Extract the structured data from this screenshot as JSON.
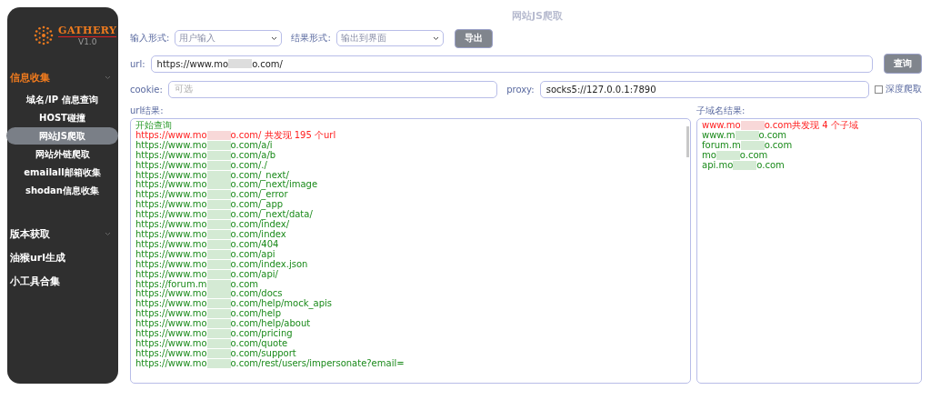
{
  "sidebar": {
    "logo": {
      "name": "GATHERY",
      "version": "V1.0"
    },
    "groups": [
      {
        "label": "信息收集",
        "expandable": true,
        "selected": true,
        "children": [
          {
            "label": "域名/IP 信息查询",
            "selected": false
          },
          {
            "label": "HOST碰撞",
            "selected": false
          },
          {
            "label": "网站JS爬取",
            "selected": true
          },
          {
            "label": "网站外链爬取",
            "selected": false
          },
          {
            "label": "emailall邮箱收集",
            "selected": false
          },
          {
            "label": "shodan信息收集",
            "selected": false
          }
        ]
      },
      {
        "label": "版本获取",
        "expandable": true,
        "selected": false
      },
      {
        "label": "油猴url生成",
        "expandable": false,
        "selected": false
      },
      {
        "label": "小工具合集",
        "expandable": false,
        "selected": false
      }
    ]
  },
  "page_title": "网站JS爬取",
  "options": {
    "input_label": "输入形式:",
    "input_value": "用户输入",
    "result_label": "结果形式:",
    "result_value": "输出到界面",
    "export_button": "导出"
  },
  "url": {
    "label": "url:",
    "prefix": "https://www.mo",
    "suffix": "o.com/",
    "button": "查询"
  },
  "cookie": {
    "label": "cookie:",
    "placeholder": "可选"
  },
  "proxy": {
    "label": "proxy:",
    "value": "socks5://127.0.0.1:7890"
  },
  "deep_crawl": {
    "label": "深度爬取",
    "checked": false
  },
  "url_results": {
    "label": "url结果:",
    "lines": [
      {
        "kind": "info",
        "text": "开始查询"
      },
      {
        "kind": "summary",
        "prefix": "https://www.mo",
        "suffix": "o.com/ 共发现 195 个url"
      },
      {
        "kind": "found",
        "prefix": "https://www.mo",
        "suffix": "o.com/a/i"
      },
      {
        "kind": "found",
        "prefix": "https://www.mo",
        "suffix": "o.com/a/b"
      },
      {
        "kind": "found",
        "prefix": "https://www.mo",
        "suffix": "o.com/./"
      },
      {
        "kind": "found",
        "prefix": "https://www.mo",
        "suffix": "o.com/_next/"
      },
      {
        "kind": "found",
        "prefix": "https://www.mo",
        "suffix": "o.com/_next/image"
      },
      {
        "kind": "found",
        "prefix": "https://www.mo",
        "suffix": "o.com/_error"
      },
      {
        "kind": "found",
        "prefix": "https://www.mo",
        "suffix": "o.com/_app"
      },
      {
        "kind": "found",
        "prefix": "https://www.mo",
        "suffix": "o.com/_next/data/"
      },
      {
        "kind": "found",
        "prefix": "https://www.mo",
        "suffix": "o.com/index/"
      },
      {
        "kind": "found",
        "prefix": "https://www.mo",
        "suffix": "o.com/index"
      },
      {
        "kind": "found",
        "prefix": "https://www.mo",
        "suffix": "o.com/404"
      },
      {
        "kind": "found",
        "prefix": "https://www.mo",
        "suffix": "o.com/api"
      },
      {
        "kind": "found",
        "prefix": "https://www.mo",
        "suffix": "o.com/index.json"
      },
      {
        "kind": "found",
        "prefix": "https://www.mo",
        "suffix": "o.com/api/"
      },
      {
        "kind": "found",
        "prefix": "https://forum.m",
        "suffix": "o.com"
      },
      {
        "kind": "found",
        "prefix": "https://www.mo",
        "suffix": "o.com/docs"
      },
      {
        "kind": "found",
        "prefix": "https://www.mo",
        "suffix": "o.com/help/mock_apis"
      },
      {
        "kind": "found",
        "prefix": "https://www.mo",
        "suffix": "o.com/help"
      },
      {
        "kind": "found",
        "prefix": "https://www.mo",
        "suffix": "o.com/help/about"
      },
      {
        "kind": "found",
        "prefix": "https://www.mo",
        "suffix": "o.com/pricing"
      },
      {
        "kind": "found",
        "prefix": "https://www.mo",
        "suffix": "o.com/quote"
      },
      {
        "kind": "found",
        "prefix": "https://www.mo",
        "suffix": "o.com/support"
      },
      {
        "kind": "found",
        "prefix": "https://www.mo",
        "suffix": "o.com/rest/users/impersonate?email="
      }
    ]
  },
  "subdomain_results": {
    "label": "子域名结果:",
    "lines": [
      {
        "kind": "summary",
        "prefix": "www.mo",
        "suffix": "o.com共发现 4 个子域"
      },
      {
        "kind": "found",
        "prefix": "www.m",
        "suffix": "o.com"
      },
      {
        "kind": "found",
        "prefix": "forum.m",
        "suffix": "o.com"
      },
      {
        "kind": "found",
        "prefix": "mo",
        "suffix": "o.com"
      },
      {
        "kind": "found",
        "prefix": "api.mo",
        "suffix": "o.com"
      }
    ]
  }
}
